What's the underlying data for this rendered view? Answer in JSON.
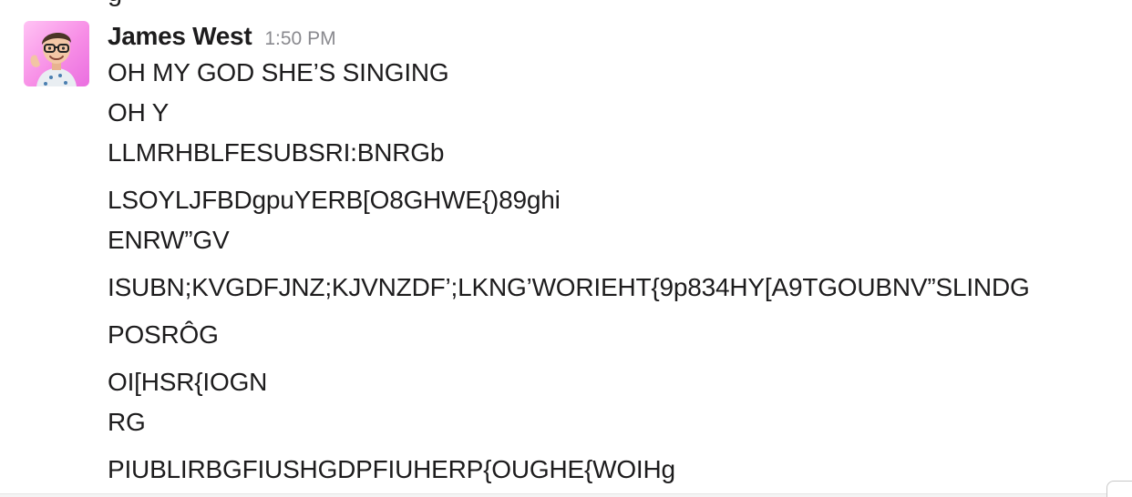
{
  "previous_message": {
    "clipped_text": "g"
  },
  "message": {
    "sender": "James West",
    "timestamp": "1:50 PM",
    "avatar_icon": "memoji-avatar-icon",
    "lines": [
      "OH MY GOD SHE’S SINGING",
      "OH  Y",
      "LLMRHBLFESUBSRI:BNRGb",
      "LSOYLJFBDgpuYERB[O8GHWE{)89ghi",
      "ENRW”GV",
      "ISUBN;KVGDFJNZ;KJVNZDF’;LKNG’WORIEHT{9p834HY[A9TGOUBNV”SLINDG",
      "POSRÔG",
      "OI[HSR{IOGN",
      "RG",
      "PIUBLIRBGFIUSHGDPFIUHERP{OUGHE{WOIHg"
    ]
  },
  "colors": {
    "text": "#1d1c1d",
    "timestamp": "#8a8a8f",
    "avatar_bg": "#f78ee6"
  }
}
